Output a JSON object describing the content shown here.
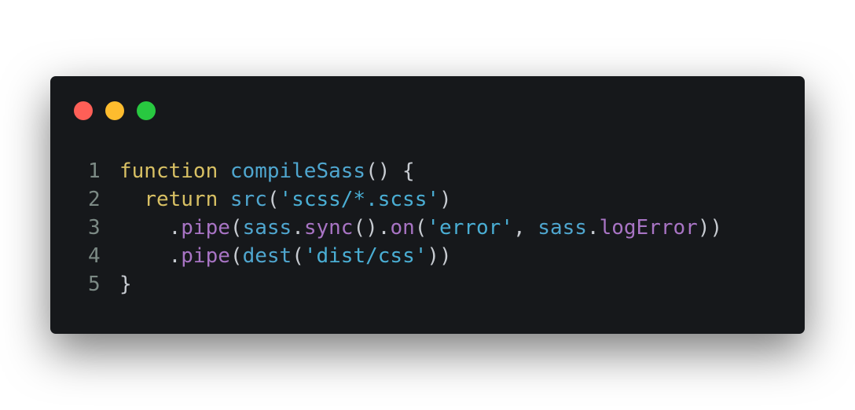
{
  "window": {
    "controls": {
      "close_color": "#fe5f57",
      "minimize_color": "#febc2e",
      "maximize_color": "#28c840",
      "close_icon": "close-dot-icon",
      "minimize_icon": "minimize-dot-icon",
      "maximize_icon": "maximize-dot-icon"
    }
  },
  "code": {
    "line_numbers": [
      "1",
      "2",
      "3",
      "4",
      "5"
    ],
    "lines": [
      [
        {
          "t": "function",
          "k": "kw"
        },
        {
          "t": " ",
          "k": "pn"
        },
        {
          "t": "compileSass",
          "k": "fn"
        },
        {
          "t": "() {",
          "k": "pn"
        }
      ],
      [
        {
          "t": "  ",
          "k": "pn"
        },
        {
          "t": "return",
          "k": "kw"
        },
        {
          "t": " ",
          "k": "pn"
        },
        {
          "t": "src",
          "k": "fn"
        },
        {
          "t": "(",
          "k": "pn"
        },
        {
          "t": "'scss/*.scss'",
          "k": "str"
        },
        {
          "t": ")",
          "k": "pn"
        }
      ],
      [
        {
          "t": "    .",
          "k": "pn"
        },
        {
          "t": "pipe",
          "k": "mth"
        },
        {
          "t": "(",
          "k": "pn"
        },
        {
          "t": "sass",
          "k": "id"
        },
        {
          "t": ".",
          "k": "pn"
        },
        {
          "t": "sync",
          "k": "mth"
        },
        {
          "t": "().",
          "k": "pn"
        },
        {
          "t": "on",
          "k": "mth"
        },
        {
          "t": "(",
          "k": "pn"
        },
        {
          "t": "'error'",
          "k": "str"
        },
        {
          "t": ", ",
          "k": "pn"
        },
        {
          "t": "sass",
          "k": "id"
        },
        {
          "t": ".",
          "k": "pn"
        },
        {
          "t": "logError",
          "k": "mth"
        },
        {
          "t": "))",
          "k": "pn"
        }
      ],
      [
        {
          "t": "    .",
          "k": "pn"
        },
        {
          "t": "pipe",
          "k": "mth"
        },
        {
          "t": "(",
          "k": "pn"
        },
        {
          "t": "dest",
          "k": "fn"
        },
        {
          "t": "(",
          "k": "pn"
        },
        {
          "t": "'dist/css'",
          "k": "str"
        },
        {
          "t": "))",
          "k": "pn"
        }
      ],
      [
        {
          "t": "}",
          "k": "pn"
        }
      ]
    ]
  }
}
